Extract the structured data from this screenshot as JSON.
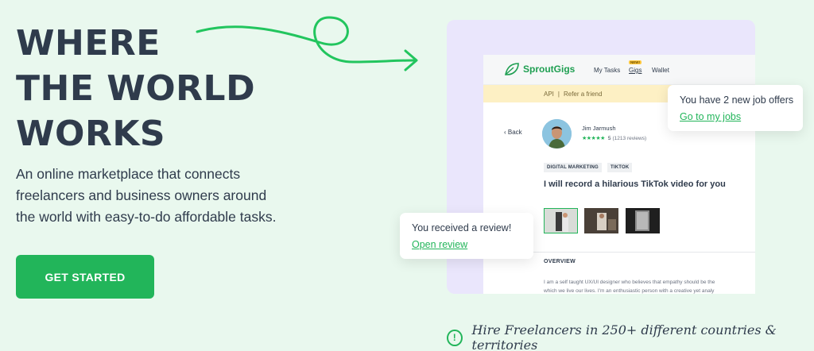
{
  "hero": {
    "title_lines": [
      "WHERE",
      "THE WORLD",
      "WORKS"
    ],
    "subtitle": "An online marketplace that connects freelancers and business owners around the world with easy-to-do affordable tasks.",
    "cta_label": "GET STARTED"
  },
  "app": {
    "brand": "SproutGigs",
    "nav": {
      "my_tasks": "My Tasks",
      "gigs": "Gigs",
      "gigs_badge": "NEW!",
      "wallet": "Wallet"
    },
    "banner": {
      "api": "API",
      "separator": "|",
      "refer": "Refer a friend"
    },
    "back_label": "‹ Back",
    "user": {
      "name": "Jim Jarmush",
      "stars": "★★★★★",
      "rating": "5",
      "reviews": "(1213 reviews)"
    },
    "tags": [
      "DIGITAL MARKETING",
      "TIKTOK"
    ],
    "gig_title": "I will record a hilarious TikTok video for you",
    "overview_label": "OVERVIEW",
    "description_lines": [
      "I am a self taught UX/UI designer who believes that empathy should be the",
      "which we live our lives. I'm an enthusiastic person with a creative yet analy"
    ]
  },
  "notifications": {
    "job_offers": {
      "text": "You have 2 new job offers",
      "link": "Go to my jobs"
    },
    "review": {
      "text": "You received a review!",
      "link": "Open review"
    }
  },
  "footer": {
    "icon": "info-icon",
    "text": "Hire Freelancers in 250+ different countries & territories"
  },
  "colors": {
    "accent": "#22b55a",
    "background": "#e9f8ee",
    "card": "#eae6fc",
    "banner": "#fdf0c4"
  }
}
